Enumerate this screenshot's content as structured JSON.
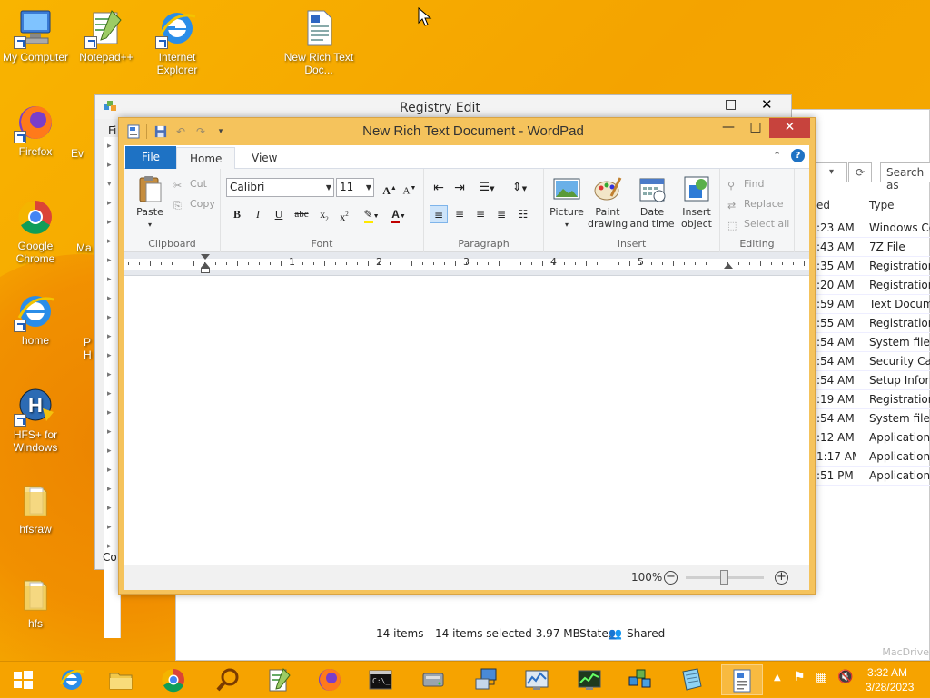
{
  "desktop_icons": [
    {
      "label": "My Computer",
      "icon": "computer-icon"
    },
    {
      "label": "Notepad++",
      "icon": "notepadpp-icon"
    },
    {
      "label": "Internet Explorer",
      "icon": "ie-icon"
    },
    {
      "label": "New Rich Text Doc...",
      "icon": "rtf-doc-icon"
    },
    {
      "label": "Firefox",
      "icon": "firefox-icon"
    },
    {
      "label": "Google Chrome",
      "icon": "chrome-icon"
    },
    {
      "label": "home",
      "icon": "ie-icon"
    },
    {
      "label": "HFS+ for Windows",
      "icon": "hfs-icon"
    },
    {
      "label": "hfsraw",
      "icon": "folder-icon"
    },
    {
      "label": "hfs",
      "icon": "folder-icon"
    }
  ],
  "partial_icons": [
    "Ev",
    "Ma",
    "P",
    "H"
  ],
  "regedit": {
    "title": "Registry Edit",
    "menu_first": "Fi",
    "status": "Co"
  },
  "explorer": {
    "search_placeholder": "Search as",
    "col_modified": "ed",
    "col_type": "Type",
    "rows": [
      {
        "modified": ":23 AM",
        "type": "Windows Co"
      },
      {
        "modified": ":43 AM",
        "type": "7Z File"
      },
      {
        "modified": ":35 AM",
        "type": "Registration"
      },
      {
        "modified": ":20 AM",
        "type": "Registration"
      },
      {
        "modified": ":59 AM",
        "type": "Text Docume"
      },
      {
        "modified": ":55 AM",
        "type": "Registration"
      },
      {
        "modified": ":54 AM",
        "type": "System file"
      },
      {
        "modified": ":54 AM",
        "type": "Security Cata"
      },
      {
        "modified": ":54 AM",
        "type": "Setup Inform"
      },
      {
        "modified": ":19 AM",
        "type": "Registration"
      },
      {
        "modified": ":54 AM",
        "type": "System file"
      },
      {
        "modified": ":12 AM",
        "type": "Application"
      },
      {
        "modified": "1:17 AM",
        "type": "Application"
      },
      {
        "modified": ":51 PM",
        "type": "Application e"
      }
    ],
    "status_items": "14 items",
    "status_selected": "14 items selected  3.97 MB",
    "status_state_label": "State:",
    "status_state_value": "Shared",
    "watermark": "MacDrive"
  },
  "wordpad": {
    "title": "New Rich Text Document - WordPad",
    "tabs": {
      "file": "File",
      "home": "Home",
      "view": "View"
    },
    "help": "?",
    "clipboard": {
      "paste": "Paste",
      "cut": "Cut",
      "copy": "Copy",
      "label": "Clipboard"
    },
    "font": {
      "family": "Calibri",
      "size": "11",
      "label": "Font"
    },
    "paragraph": {
      "label": "Paragraph"
    },
    "insert": {
      "picture": "Picture",
      "paint_drawing": "Paint drawing",
      "date_time": "Date and time",
      "insert_object": "Insert object",
      "label": "Insert"
    },
    "editing": {
      "find": "Find",
      "replace": "Replace",
      "select_all": "Select all",
      "label": "Editing"
    },
    "ruler_numbers": [
      "1",
      "2",
      "3",
      "4",
      "5"
    ],
    "zoom": "100%"
  },
  "taskbar": {
    "time": "3:32 AM",
    "date": "3/28/2023"
  },
  "colors": {
    "desktop": "#f5a800",
    "file_tab": "#1e72c4",
    "close_button": "#c7433d",
    "wordpad_frame": "#f5c35c"
  }
}
